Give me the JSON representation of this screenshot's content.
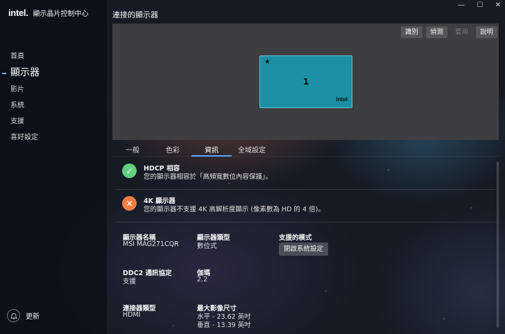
{
  "app": {
    "logo_text": "intel.",
    "title": "顯示晶片控制中心"
  },
  "sidebar": {
    "items": [
      {
        "label": "首頁"
      },
      {
        "label": "顯示器"
      },
      {
        "label": "影片"
      },
      {
        "label": "系統"
      },
      {
        "label": "支援"
      },
      {
        "label": "喜好設定"
      }
    ],
    "active_index": 1,
    "update_label": "更新"
  },
  "window_controls": {
    "minimize": "—",
    "maximize": "☐",
    "close": "✕"
  },
  "page": {
    "title": "連接的顯示器"
  },
  "toolbar": {
    "identify": "識別",
    "detect": "偵測",
    "apply": "套用",
    "help": "說明"
  },
  "monitor": {
    "number": "1",
    "star": "★",
    "logo": "intel"
  },
  "tabs": [
    "一般",
    "色彩",
    "資訊",
    "全域設定"
  ],
  "active_tab": 2,
  "status": [
    {
      "title": "HDCP 相容",
      "description": "您的顯示器相容於「高頻寬數位內容保護」。",
      "state": "ok",
      "icon": "✓",
      "color": "#5fcf7b"
    },
    {
      "title": "4K 顯示器",
      "description": "您的顯示器不支援 4K 高解析度顯示 (像素數為 HD 的 4 倍)。",
      "state": "warn",
      "icon": "✕",
      "color": "#f07f45"
    }
  ],
  "info": {
    "display_name_label": "顯示器名稱",
    "display_name_value": "MSI MAG271CQR",
    "display_type_label": "顯示器類型",
    "display_type_value": "數位式",
    "supported_modes_label": "支援的模式",
    "open_system_settings": "開啟系統設定",
    "ddc2_label": "DDC2 通訊協定",
    "ddc2_value": "支援",
    "gamma_label": "伽瑪",
    "gamma_value": "2.2",
    "connector_label": "連接器類型",
    "connector_value": "HDMI",
    "max_image_size_label": "最大影像尺寸",
    "horizontal_value": "水平 - 23.62 英吋",
    "vertical_value": "垂直 - 13.39 英吋"
  }
}
